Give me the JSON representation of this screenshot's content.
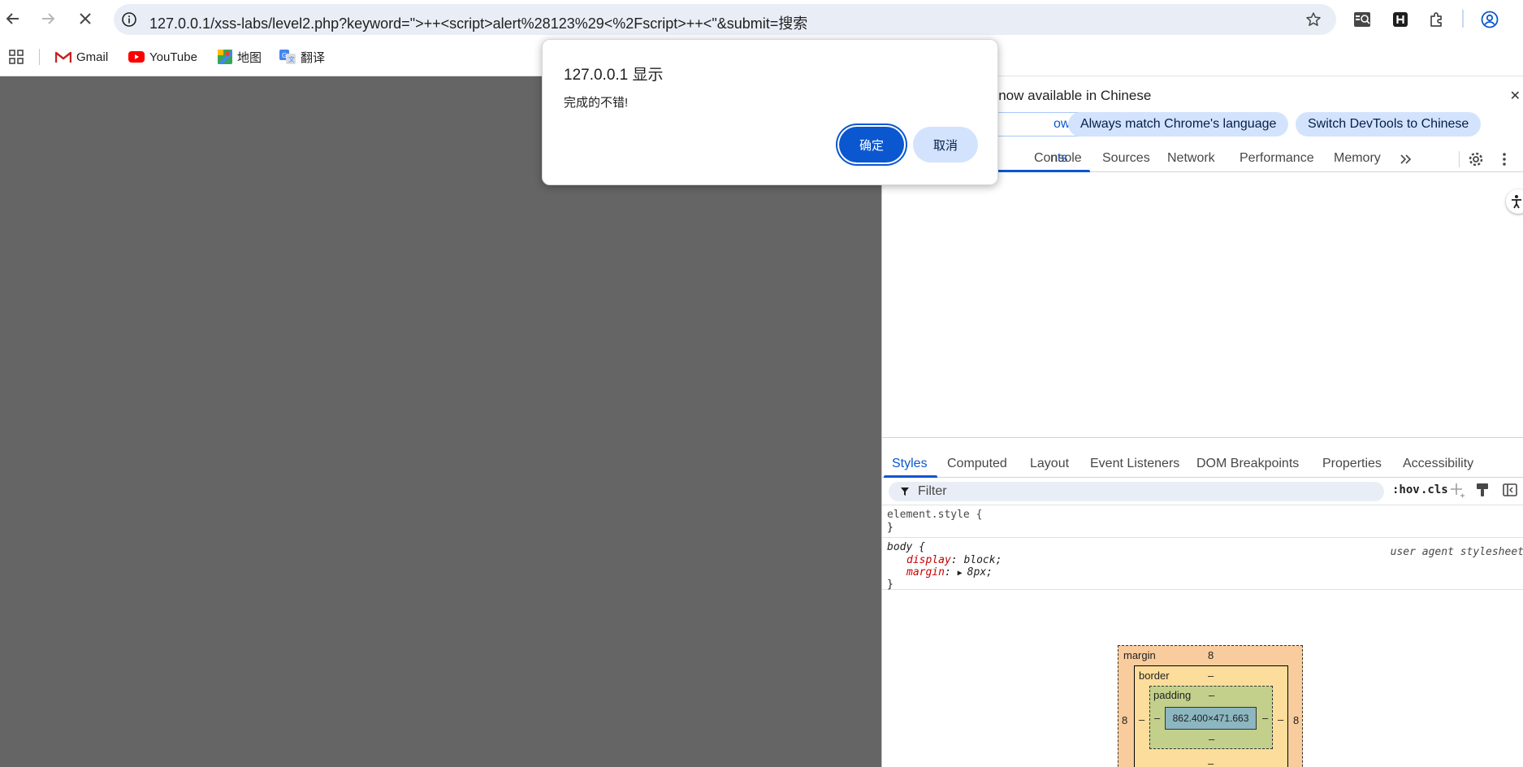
{
  "browser": {
    "url": "127.0.0.1/xss-labs/level2.php?keyword=\">++<script>alert%28123%29<%2Fscript>++<\"&submit=搜索"
  },
  "bookmarks": [
    {
      "label": "Gmail",
      "icon": "gmail-icon"
    },
    {
      "label": "YouTube",
      "icon": "youtube-icon"
    },
    {
      "label": "地图",
      "icon": "maps-icon"
    },
    {
      "label": "翻译",
      "icon": "translate-icon"
    }
  ],
  "dialog": {
    "title": "127.0.0.1 显示",
    "message": "完成的不错!",
    "ok_label": "确定",
    "cancel_label": "取消"
  },
  "devtools": {
    "infobar": {
      "message": "s now available in Chinese",
      "dont_show_label": "ow again",
      "match_language_label": "Always match Chrome's language",
      "switch_label": "Switch DevTools to Chinese"
    },
    "tabs": [
      "nts",
      "Console",
      "Sources",
      "Network",
      "Performance",
      "Memory"
    ],
    "styles_tabs": [
      "Styles",
      "Computed",
      "Layout",
      "Event Listeners",
      "DOM Breakpoints",
      "Properties",
      "Accessibility"
    ],
    "filter_placeholder": "Filter",
    "hov_label": ":hov",
    "cls_label": ".cls",
    "rules": {
      "element_style_open": "element.style {",
      "close": "}",
      "body_selector": "body {",
      "body_source": "user agent stylesheet",
      "display_prop": "display",
      "display_val": "block;",
      "margin_prop": "margin",
      "margin_val": "8px;"
    },
    "box_model": {
      "margin_label": "margin",
      "margin_top": "8",
      "margin_left": "8",
      "margin_right": "8",
      "border_label": "border",
      "border_value": "–",
      "padding_label": "padding",
      "padding_value": "–",
      "content": "862.400×471.663"
    }
  },
  "colors": {
    "accent": "#0b57d0",
    "overlay": "#656565"
  }
}
